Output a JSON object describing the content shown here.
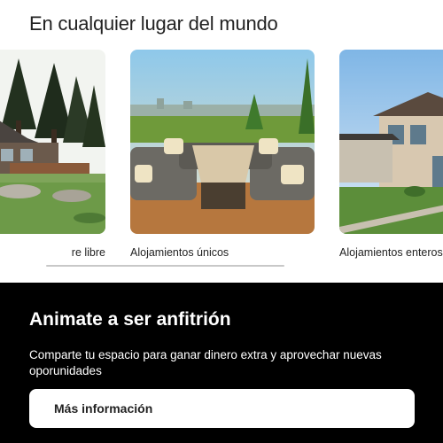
{
  "section": {
    "title": "En cualquier lugar del mundo"
  },
  "cards": [
    {
      "label": "re libre"
    },
    {
      "label": "Alojamientos únicos"
    },
    {
      "label": "Alojamientos enteros"
    }
  ],
  "promo": {
    "title": "Animate a ser anfitrión",
    "text": "Comparte tu espacio para ganar dinero extra y aprovechar nuevas oporunidades",
    "button_label": "Más información"
  },
  "colors": {
    "text": "#222222",
    "promo_background": "#000000",
    "button_background": "#ffffff"
  }
}
